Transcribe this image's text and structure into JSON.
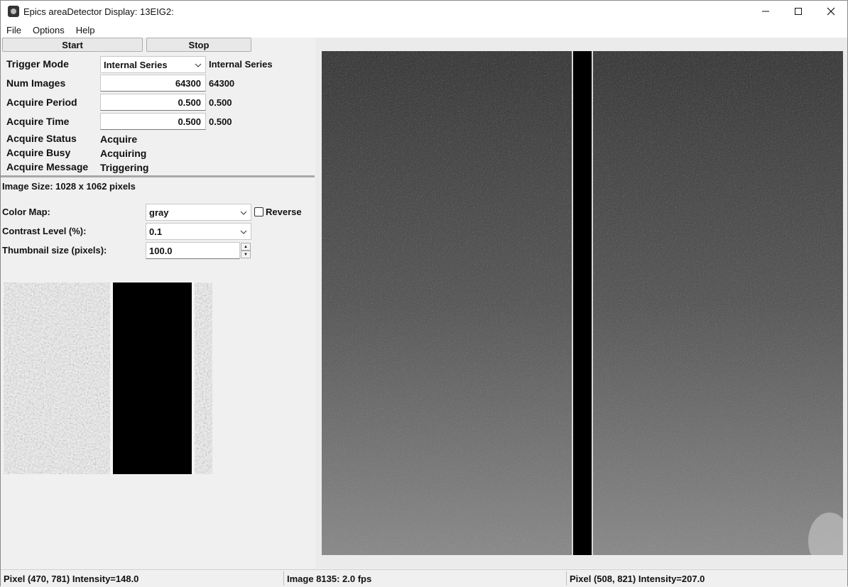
{
  "window": {
    "title": "Epics areaDetector Display: 13EIG2:"
  },
  "menu": {
    "file": "File",
    "options": "Options",
    "help": "Help"
  },
  "controls": {
    "start_label": "Start",
    "stop_label": "Stop",
    "trigger_mode": {
      "label": "Trigger Mode",
      "selected": "Internal Series",
      "readback": "Internal Series"
    },
    "num_images": {
      "label": "Num Images",
      "value": "64300",
      "readback": "64300"
    },
    "acquire_period": {
      "label": "Acquire Period",
      "value": "0.500",
      "readback": "0.500"
    },
    "acquire_time": {
      "label": "Acquire Time",
      "value": "0.500",
      "readback": "0.500"
    },
    "acquire_status": {
      "label": "Acquire Status",
      "value": "Acquire"
    },
    "acquire_busy": {
      "label": "Acquire Busy",
      "value": "Acquiring"
    },
    "acquire_message": {
      "label": "Acquire Message",
      "value": "Triggering"
    }
  },
  "display": {
    "image_size": "Image Size: 1028 x 1062 pixels",
    "color_map": {
      "label": "Color Map:",
      "selected": "gray"
    },
    "reverse_label": "Reverse",
    "reverse_checked": false,
    "contrast": {
      "label": "Contrast Level (%):",
      "selected": "0.1"
    },
    "thumbnail": {
      "label": "Thumbnail size (pixels):",
      "value": "100.0"
    }
  },
  "status": {
    "left": "Pixel (470, 781) Intensity=148.0",
    "middle": "Image 8135:  2.0 fps",
    "right": "Pixel (508, 821) Intensity=207.0"
  },
  "colors": {
    "window_bg": "#f0f0f0",
    "image_gap": "#000000"
  },
  "icons": {
    "app": "camera-icon",
    "minimize": "minimize-icon",
    "maximize": "maximize-icon",
    "close": "close-icon"
  }
}
